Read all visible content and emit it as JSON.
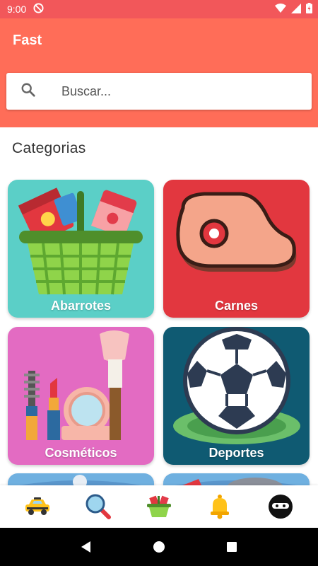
{
  "status_bar": {
    "time": "9:00"
  },
  "app": {
    "title": "Fast"
  },
  "search": {
    "placeholder": "Buscar..."
  },
  "section": {
    "title": "Categorias"
  },
  "categories": [
    {
      "label": "Abarrotes",
      "color": "#5bcfc7"
    },
    {
      "label": "Carnes",
      "color": "#e2373f"
    },
    {
      "label": "Cosméticos",
      "color": "#e36bc2"
    },
    {
      "label": "Deportes",
      "color": "#0f5a72"
    }
  ],
  "bottom_nav": [
    {
      "icon": "taxi-icon"
    },
    {
      "icon": "search-icon"
    },
    {
      "icon": "basket-icon"
    },
    {
      "icon": "bell-icon"
    },
    {
      "icon": "ninja-icon"
    }
  ],
  "colors": {
    "header": "#ff6d58",
    "status_bar": "#f2575a"
  }
}
